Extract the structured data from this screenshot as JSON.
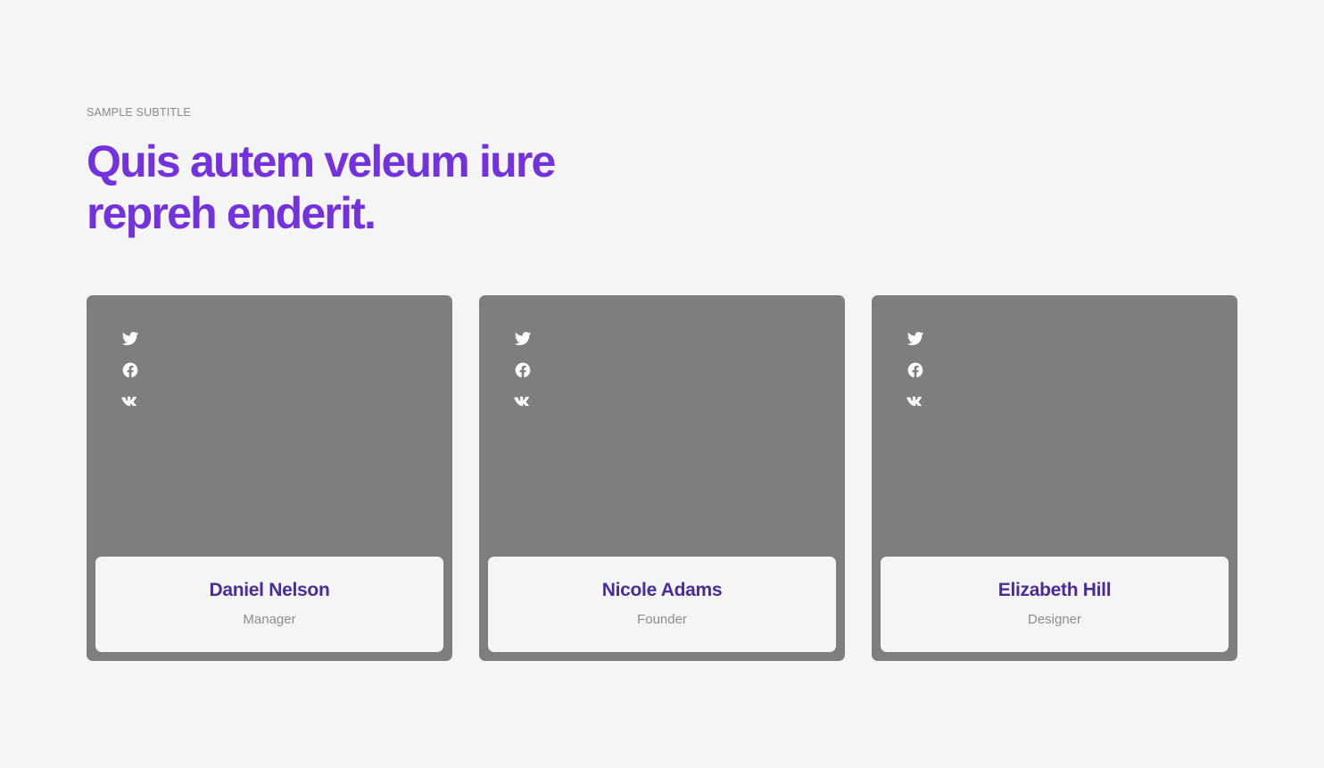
{
  "header": {
    "subtitle": "SAMPLE SUBTITLE",
    "title": "Quis autem veleum iure repreh enderit."
  },
  "colors": {
    "accent": "#7332dd",
    "card_bg": "#7d7e80",
    "name": "#4a2b9a",
    "page_bg": "#f5f5f5"
  },
  "team": [
    {
      "name": "Daniel Nelson",
      "role": "Manager",
      "socials": [
        "twitter-icon",
        "facebook-icon",
        "vk-icon"
      ]
    },
    {
      "name": "Nicole Adams",
      "role": "Founder",
      "socials": [
        "twitter-icon",
        "facebook-icon",
        "vk-icon"
      ]
    },
    {
      "name": "Elizabeth Hill",
      "role": "Designer",
      "socials": [
        "twitter-icon",
        "facebook-icon",
        "vk-icon"
      ]
    }
  ]
}
